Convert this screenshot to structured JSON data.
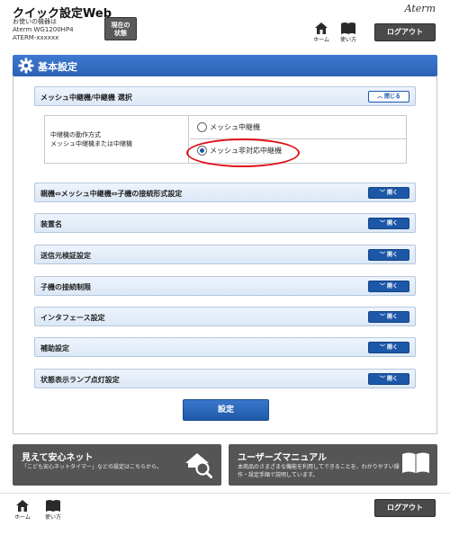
{
  "header": {
    "title": "クイック設定Web",
    "device_line1": "お使いの機器は",
    "device_line2": "Aterm WG1200HP4",
    "device_line3": "ATERM-xxxxxx",
    "status_line1": "現在の",
    "status_line2": "状態",
    "brand": "Aterm",
    "home_label": "ホーム",
    "help_label": "使い方",
    "logout_label": "ログアウト"
  },
  "section": {
    "title": "基本設定"
  },
  "panels": [
    {
      "title": "メッシュ中継機/中継機 選択",
      "toggle": "閉じる",
      "state": "expanded"
    },
    {
      "title": "親機⇔メッシュ中継機⇔子機の接続形式設定",
      "toggle": "開く"
    },
    {
      "title": "装置名",
      "toggle": "開く"
    },
    {
      "title": "送信元検証設定",
      "toggle": "開く"
    },
    {
      "title": "子機の接続制限",
      "toggle": "開く"
    },
    {
      "title": "インタフェース設定",
      "toggle": "開く"
    },
    {
      "title": "補助設定",
      "toggle": "開く"
    },
    {
      "title": "状態表示ランプ点灯設定",
      "toggle": "開く"
    }
  ],
  "mode_setting": {
    "label_line1": "中継機の動作方式",
    "label_line2": "メッシュ中継機または中継機",
    "options": [
      "メッシュ中継機",
      "メッシュ非対応中継機"
    ],
    "selected": "メッシュ非対応中継機"
  },
  "submit_label": "設定",
  "banners": {
    "safety": {
      "title": "見えて安心ネット",
      "desc": "「こども安心ネットタイマー」などの設定はこちらから。"
    },
    "manual": {
      "title": "ユーザーズマニュアル",
      "desc_line1": "本商品のさまざまな機能を利用してできることを、わかりやすい操",
      "desc_line2": "作・設定手順で説明しています。"
    }
  },
  "footer": {
    "home_label": "ホーム",
    "help_label": "使い方",
    "logout_label": "ログアウト"
  },
  "colors": {
    "accent_blue": "#2b62b4",
    "button_blue": "#1c57a8",
    "highlight_red": "#e0101a",
    "banner_gray": "#555555"
  }
}
